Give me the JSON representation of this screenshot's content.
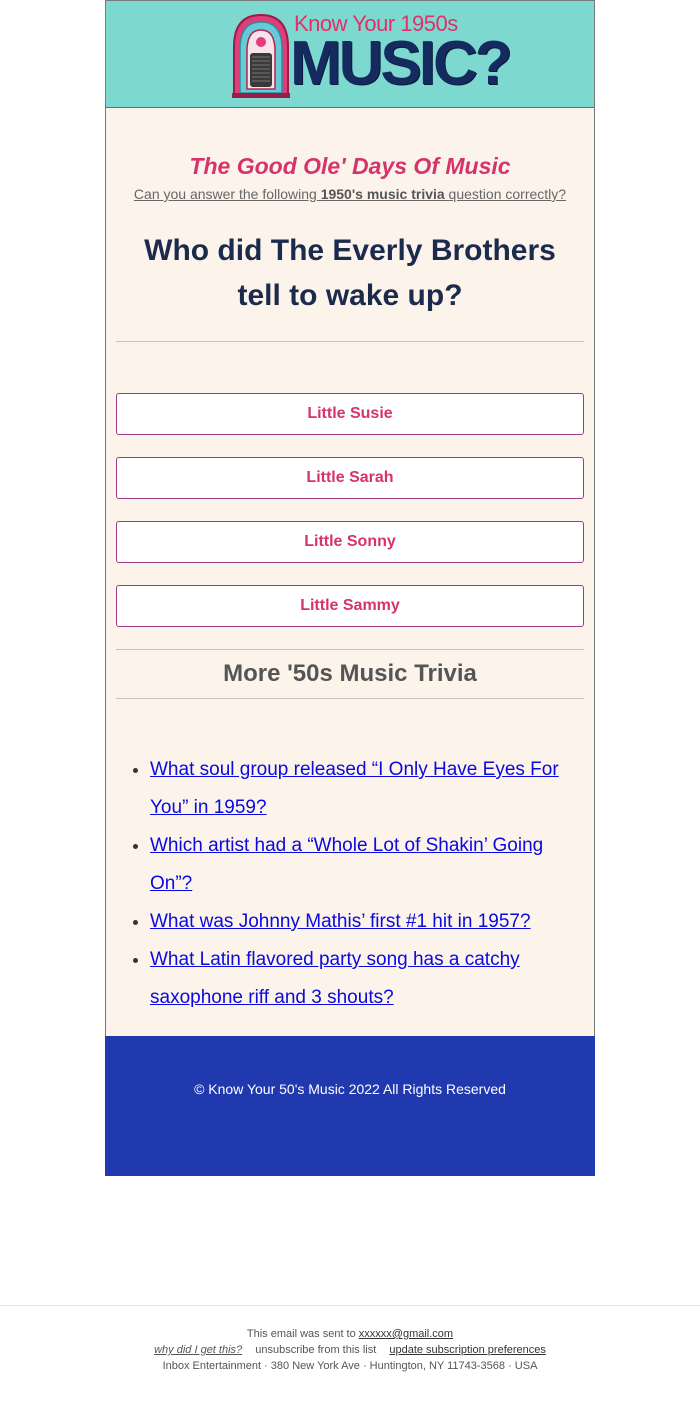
{
  "header": {
    "logo_small": "Know Your 1950s",
    "logo_big": "MUSIC?"
  },
  "intro": {
    "tagline": "The Good Ole' Days Of Music",
    "subline_pre": "Can you answer the following ",
    "subline_bold": "1950's music trivia",
    "subline_post": " question correctly?"
  },
  "question": "Who did The Everly Brothers tell to wake up?",
  "answers": [
    {
      "label": "Little Susie"
    },
    {
      "label": "Little Sarah"
    },
    {
      "label": "Little Sonny"
    },
    {
      "label": "Little Sammy"
    }
  ],
  "more": {
    "title": "More '50s Music Trivia",
    "links": [
      {
        "label": "What soul group released “I Only Have Eyes For You” in 1959? "
      },
      {
        "label": "Which artist had a “Whole Lot of Shakin’ Going On”? "
      },
      {
        "label": "What was Johnny Mathis’ first #1 hit in 1957?"
      },
      {
        "label": "What Latin flavored party song has a catchy saxophone riff and 3 shouts? "
      }
    ]
  },
  "footer": {
    "copyright": "© Know Your 50's Music 2022 All Rights Reserved"
  },
  "legal": {
    "sent_to_pre": "This email was sent to ",
    "email": "xxxxxx@gmail.com",
    "why": "why did I get this?",
    "unsubscribe": "unsubscribe from this list",
    "update": "update subscription preferences",
    "address": "Inbox Entertainment · 380 New York Ave · Huntington, NY 11743-3568 · USA"
  },
  "colors": {
    "header_bg": "#7dd9cf",
    "body_bg": "#fcf4ea",
    "accent_pink": "#d6336c",
    "title_navy": "#1c2b4d",
    "footer_blue": "#2139ae",
    "link_blue": "#0a0ae0"
  }
}
